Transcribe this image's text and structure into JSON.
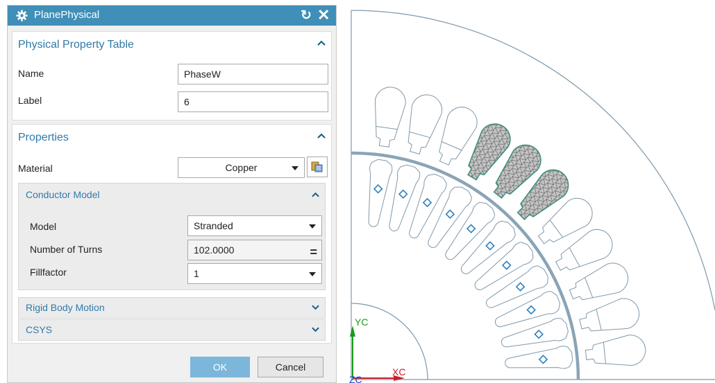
{
  "dialog": {
    "title": "PlanePhysical",
    "icon": "gear-icon",
    "title_color": "#3f8fb8"
  },
  "physical_property_table": {
    "title": "Physical Property Table",
    "name_label": "Name",
    "name_value": "PhaseW",
    "label_label": "Label",
    "label_value": "6"
  },
  "properties": {
    "title": "Properties",
    "material_label": "Material",
    "material_value": "Copper",
    "conductor_model": {
      "title": "Conductor Model",
      "model_label": "Model",
      "model_value": "Stranded",
      "turns_label": "Number of Turns",
      "turns_value": "102.0000",
      "fillfactor_label": "Fillfactor",
      "fillfactor_value": "1"
    },
    "rigid_body_motion": {
      "title": "Rigid Body Motion"
    },
    "csys": {
      "title": "CSYS"
    }
  },
  "buttons": {
    "ok": "OK",
    "cancel": "Cancel"
  },
  "viewport": {
    "axis_labels": {
      "y": "YC",
      "x": "XC",
      "z": "ZC"
    },
    "colors": {
      "outline": "#7e98ab",
      "ring": "#8aa4b6",
      "mesh_fill": "#c4c4c4",
      "mesh_edge": "#3e8f7e",
      "marker": "#2a7fc0"
    }
  }
}
